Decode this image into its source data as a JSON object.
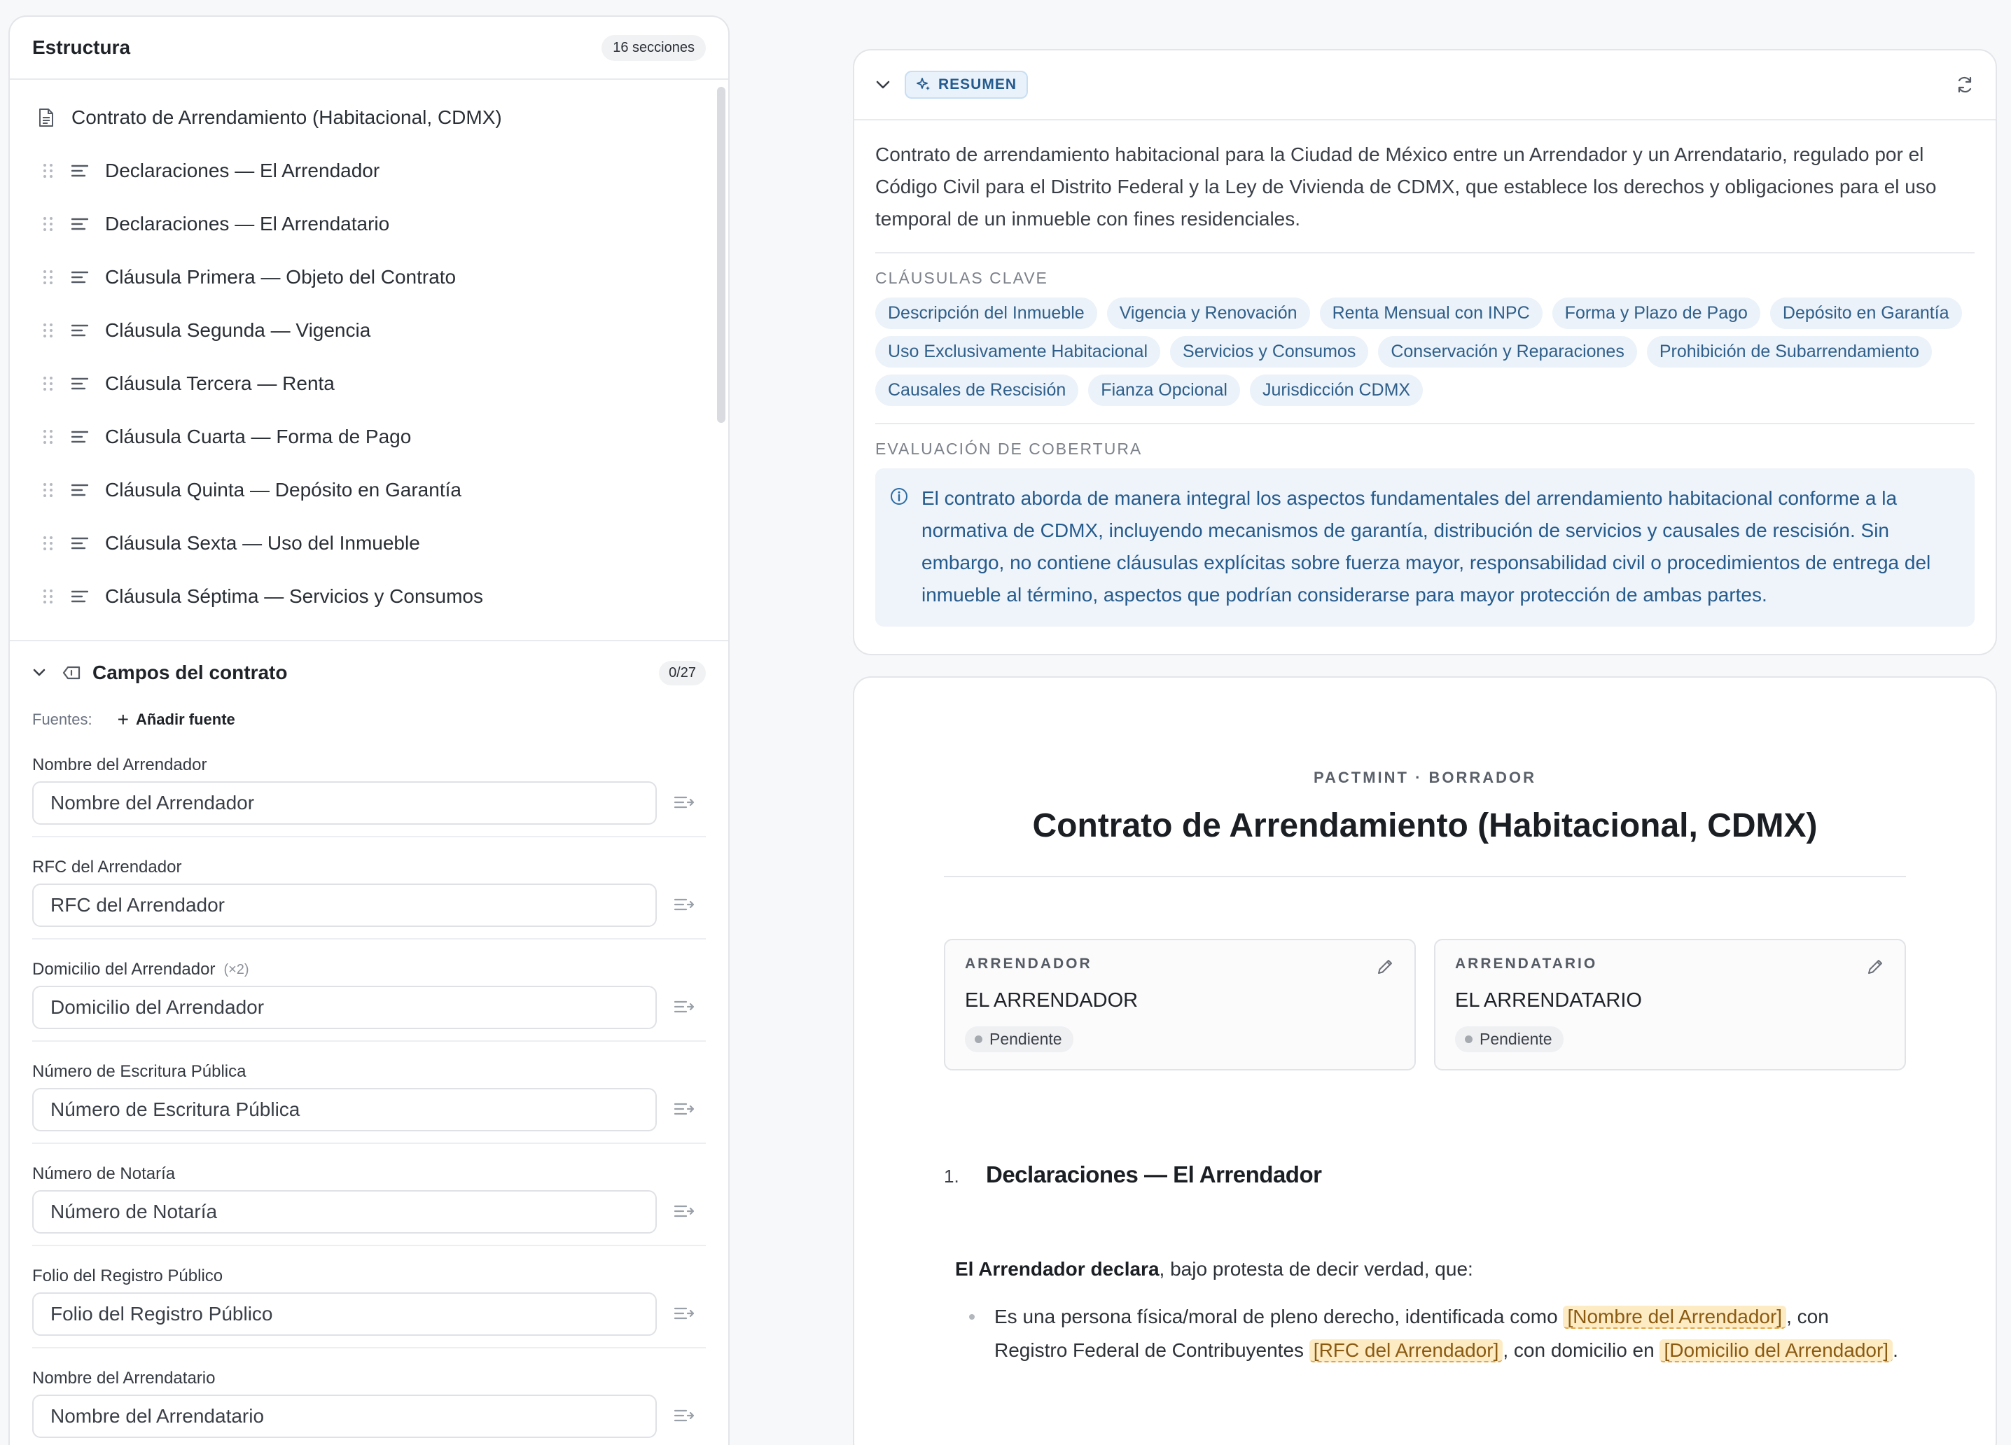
{
  "structure": {
    "title": "Estructura",
    "count": "16 secciones",
    "root": "Contrato de Arrendamiento (Habitacional, CDMX)",
    "items": [
      "Declaraciones — El Arrendador",
      "Declaraciones — El Arrendatario",
      "Cláusula Primera — Objeto del Contrato",
      "Cláusula Segunda — Vigencia",
      "Cláusula Tercera — Renta",
      "Cláusula Cuarta — Forma de Pago",
      "Cláusula Quinta — Depósito en Garantía",
      "Cláusula Sexta — Uso del Inmueble",
      "Cláusula Séptima — Servicios y Consumos"
    ]
  },
  "fields": {
    "title": "Campos del contrato",
    "count": "0/27",
    "sources_label": "Fuentes:",
    "add_source": "Añadir fuente",
    "list": [
      {
        "label": "Nombre del Arrendador",
        "placeholder": "Nombre del Arrendador",
        "multiplier": ""
      },
      {
        "label": "RFC del Arrendador",
        "placeholder": "RFC del Arrendador",
        "multiplier": ""
      },
      {
        "label": "Domicilio del Arrendador",
        "placeholder": "Domicilio del Arrendador",
        "multiplier": "(×2)"
      },
      {
        "label": "Número de Escritura Pública",
        "placeholder": "Número de Escritura Pública",
        "multiplier": ""
      },
      {
        "label": "Número de Notaría",
        "placeholder": "Número de Notaría",
        "multiplier": ""
      },
      {
        "label": "Folio del Registro Público",
        "placeholder": "Folio del Registro Público",
        "multiplier": ""
      },
      {
        "label": "Nombre del Arrendatario",
        "placeholder": "Nombre del Arrendatario",
        "multiplier": ""
      }
    ]
  },
  "summary": {
    "badge": "RESUMEN",
    "text": "Contrato de arrendamiento habitacional para la Ciudad de México entre un Arrendador y un Arrendatario, regulado por el Código Civil para el Distrito Federal y la Ley de Vivienda de CDMX, que establece los derechos y obligaciones para el uso temporal de un inmueble con fines residenciales.",
    "key_clauses_title": "CLÁUSULAS CLAVE",
    "key_clauses": [
      "Descripción del Inmueble",
      "Vigencia y Renovación",
      "Renta Mensual con INPC",
      "Forma y Plazo de Pago",
      "Depósito en Garantía",
      "Uso Exclusivamente Habitacional",
      "Servicios y Consumos",
      "Conservación y Reparaciones",
      "Prohibición de Subarrendamiento",
      "Causales de Rescisión",
      "Fianza Opcional",
      "Jurisdicción CDMX"
    ],
    "coverage_title": "EVALUACIÓN DE COBERTURA",
    "coverage_text": "El contrato aborda de manera integral los aspectos fundamentales del arrendamiento habitacional conforme a la normativa de CDMX, incluyendo mecanismos de garantía, distribución de servicios y causales de rescisión. Sin embargo, no contiene cláusulas explícitas sobre fuerza mayor, responsabilidad civil o procedimientos de entrega del inmueble al término, aspectos que podrían considerarse para mayor protección de ambas partes."
  },
  "document": {
    "kicker": "PACTMINT · BORRADOR",
    "title": "Contrato de Arrendamiento (Habitacional, CDMX)",
    "parties": [
      {
        "role": "ARRENDADOR",
        "name": "EL ARRENDADOR",
        "status": "Pendiente"
      },
      {
        "role": "ARRENDATARIO",
        "name": "EL ARRENDATARIO",
        "status": "Pendiente"
      }
    ],
    "section": {
      "num": "1.",
      "title": "Declaraciones — El Arrendador"
    },
    "intro_bold": "El Arrendador declara",
    "intro_rest": ", bajo protesta de decir verdad, que:",
    "bullet": {
      "t1": "Es una persona física/moral de pleno derecho, identificada como ",
      "p1": "[Nombre del Arrendador]",
      "t2": ", con Registro Federal de Contribuyentes ",
      "p2": "[RFC del Arrendador]",
      "t3": ", con domicilio en ",
      "p3": "[Domicilio del Arrendador]",
      "t4": "."
    }
  }
}
